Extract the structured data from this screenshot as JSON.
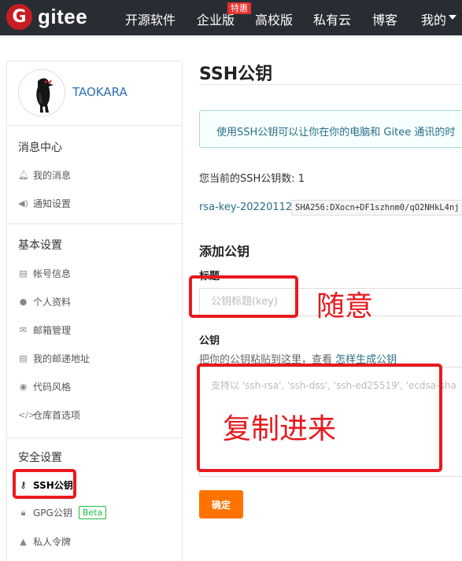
{
  "header": {
    "logo_letter": "G",
    "logo_text": "gitee",
    "nav": [
      "开源软件",
      "企业版",
      "高校版",
      "私有云",
      "博客",
      "我的"
    ],
    "hot_badge": "特惠"
  },
  "sidebar": {
    "username": "TAOKARA",
    "groups": [
      {
        "title": "消息中心",
        "items": [
          {
            "label": "我的消息",
            "icon": "bell-icon"
          },
          {
            "label": "通知设置",
            "icon": "speaker-icon"
          }
        ]
      },
      {
        "title": "基本设置",
        "items": [
          {
            "label": "帐号信息",
            "icon": "id-card-icon"
          },
          {
            "label": "个人资料",
            "icon": "user-icon"
          },
          {
            "label": "邮箱管理",
            "icon": "envelope-icon"
          },
          {
            "label": "我的邮递地址",
            "icon": "address-card-icon"
          },
          {
            "label": "代码风格",
            "icon": "palette-icon"
          },
          {
            "label": "仓库首选项",
            "icon": "code-icon"
          }
        ]
      },
      {
        "title": "安全设置",
        "items": [
          {
            "label": "SSH公钥",
            "icon": "key-icon",
            "active": true
          },
          {
            "label": "GPG公钥",
            "icon": "lock-icon",
            "badge": "Beta"
          },
          {
            "label": "私人令牌",
            "icon": "person-badge-icon"
          }
        ]
      }
    ]
  },
  "main": {
    "title": "SSH公钥",
    "info": "使用SSH公钥可以让你在你的电脑和 Gitee 通讯的时",
    "key_count_label": "您当前的SSH公钥数: 1",
    "key_name": "rsa-key-20220112",
    "fingerprint": "SHA256:DXocn+DF1szhnm0/qO2NHkL4nj",
    "add_title": "添加公钥",
    "title_label": "标题",
    "title_placeholder": "公钥标题(key)",
    "key_label": "公钥",
    "key_hint": "把你的公钥粘贴到这里，查看",
    "key_hint_link": "怎样生成公钥",
    "key_placeholder": "支持以 'ssh-rsa', 'ssh-dss', 'ssh-ed25519', 'ecdsa-sha",
    "submit_label": "确定"
  },
  "annotations": {
    "title_note": "随意",
    "key_note": "复制进来",
    "color": "#e8191e"
  },
  "colors": {
    "topbar": "#282d33",
    "brand_red": "#c71d23",
    "submit": "#fe7300",
    "link": "#276f86"
  }
}
